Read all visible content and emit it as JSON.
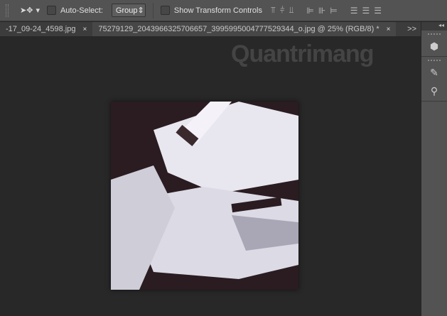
{
  "options_bar": {
    "auto_select_label": "Auto-Select:",
    "auto_select_checked": false,
    "group_value": "Group",
    "show_transform_label": "Show Transform Controls",
    "show_transform_checked": false
  },
  "tabs": [
    {
      "label": "-17_09-24_4598.jpg",
      "close": "×"
    },
    {
      "label": "75279129_2043966325706657_3995995004777529344_o.jpg @ 25% (RGB/8) *",
      "close": "×"
    }
  ],
  "tabs_overflow": ">>",
  "panel": {
    "collapse": "◂◂"
  },
  "watermark": "Quantrimang"
}
